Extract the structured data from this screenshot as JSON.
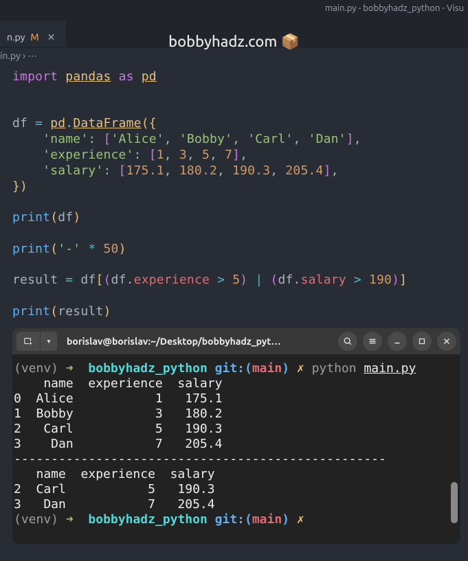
{
  "window": {
    "title": "main.py - bobbyhadz_python - Visu"
  },
  "tab": {
    "name": "n.py",
    "badge": "M"
  },
  "overlay": {
    "text": "bobbyhadz.com",
    "icon": "📦"
  },
  "breadcrumb": {
    "text": "in.py › ⋯"
  },
  "code": {
    "l1_import": "import",
    "l1_pandas": "pandas",
    "l1_as": "as",
    "l1_pd": "pd",
    "l4_df": "df",
    "l4_eq": "=",
    "l4_pd": "pd",
    "l4_dot": ".",
    "l4_DataFrame": "DataFrame",
    "l4_open": "({",
    "l5_key": "'name'",
    "l5_col": ":",
    "l5_ob": "[",
    "l5_v1": "'Alice'",
    "l5_v2": "'Bobby'",
    "l5_v3": "'Carl'",
    "l5_v4": "'Dan'",
    "l5_cb": "]",
    "l5_comma": ",",
    "l6_key": "'experience'",
    "l6_ob": "[",
    "l6_v1": "1",
    "l6_v2": "3",
    "l6_v3": "5",
    "l6_v4": "7",
    "l6_cb": "]",
    "l7_key": "'salary'",
    "l7_ob": "[",
    "l7_v1": "175.1",
    "l7_v2": "180.2",
    "l7_v3": "190.3",
    "l7_v4": "205.4",
    "l7_cb": "]",
    "l8_close": "})",
    "l10_print": "print",
    "l10_op": "(",
    "l10_df": "df",
    "l10_cp": ")",
    "l12_print": "print",
    "l12_op": "(",
    "l12_str": "'-'",
    "l12_star": "*",
    "l12_num": "50",
    "l12_cp": ")",
    "l14_result": "result",
    "l14_eq": "=",
    "l14_df": "df",
    "l14_ob": "[",
    "l14_p1o": "(",
    "l14_df2": "df",
    "l14_dot": ".",
    "l14_exp": "experience",
    "l14_gt": ">",
    "l14_5": "5",
    "l14_p1c": ")",
    "l14_pipe": "|",
    "l14_p2o": "(",
    "l14_df3": "df",
    "l14_dot2": ".",
    "l14_sal": "salary",
    "l14_gt2": ">",
    "l14_190": "190",
    "l14_p2c": ")",
    "l14_cb": "]",
    "l16_print": "print",
    "l16_op": "(",
    "l16_result": "result",
    "l16_cp": ")"
  },
  "terminal": {
    "title": "borislav@borislav:~/Desktop/bobbyhadz_pyt…",
    "prompt_venv": "(venv)",
    "prompt_arrow": "➜",
    "prompt_dir": "bobbyhadz_python",
    "prompt_git": "git:(",
    "prompt_branch": "main",
    "prompt_gitc": ")",
    "prompt_x": "✗",
    "prompt_cmd": "python",
    "prompt_file": "main.py",
    "out": [
      "    name  experience  salary",
      "0  Alice           1   175.1",
      "1  Bobby           3   180.2",
      "2   Carl           5   190.3",
      "3    Dan           7   205.4",
      "--------------------------------------------------",
      "   name  experience  salary",
      "2  Carl           5   190.3",
      "3   Dan           7   205.4"
    ]
  },
  "chart_data": {
    "type": "table",
    "title": "DataFrame output",
    "columns": [
      "name",
      "experience",
      "salary"
    ],
    "rows": [
      [
        "Alice",
        1,
        175.1
      ],
      [
        "Bobby",
        3,
        180.2
      ],
      [
        "Carl",
        5,
        190.3
      ],
      [
        "Dan",
        7,
        205.4
      ]
    ],
    "filter": "(experience > 5) | (salary > 190)",
    "filtered_rows": [
      [
        "Carl",
        5,
        190.3
      ],
      [
        "Dan",
        7,
        205.4
      ]
    ]
  }
}
